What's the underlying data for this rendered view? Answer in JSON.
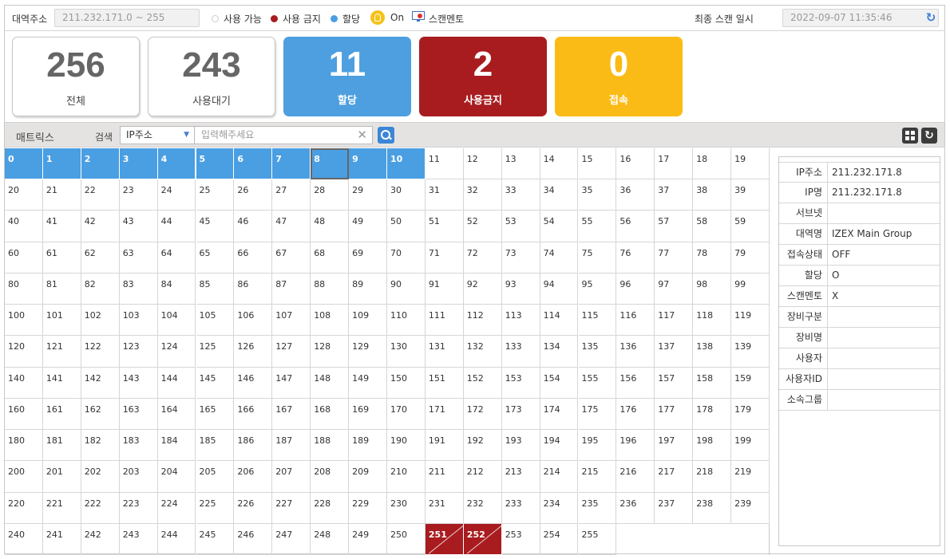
{
  "topbar": {
    "range_label": "대역주소",
    "range_value": "211.232.171.0 ~ 255",
    "legend_available": "사용 가능",
    "legend_blocked": "사용 금지",
    "legend_assigned": "할당",
    "on_label": "On",
    "scanmento_label": "스캔멘토",
    "last_scan_label": "최종 스캔 일시",
    "last_scan_value": "2022-09-07 11:35:46",
    "refresh_icon": "refresh-icon"
  },
  "colors": {
    "assigned": "#4a9ee2",
    "blocked": "#a81c1f",
    "connected": "#fbbb16",
    "available_dot": "#ffffff"
  },
  "cards": [
    {
      "value": "256",
      "label": "전체",
      "style": "white"
    },
    {
      "value": "243",
      "label": "사용대기",
      "style": "white"
    },
    {
      "value": "11",
      "label": "할당",
      "style": "assigned",
      "color": "#4d9fe0"
    },
    {
      "value": "2",
      "label": "사용금지",
      "style": "blocked",
      "color": "#a81c1f"
    },
    {
      "value": "0",
      "label": "접속",
      "style": "connected",
      "color": "#fbbb16"
    }
  ],
  "matrix_header": {
    "title": "매트릭스",
    "search_label": "검색",
    "select_value": "IP주소",
    "input_placeholder": "입력해주세요"
  },
  "matrix": {
    "count": 256,
    "columns": 20,
    "assigned": [
      0,
      1,
      2,
      3,
      4,
      5,
      6,
      7,
      8,
      9,
      10
    ],
    "blocked": [
      251,
      252
    ],
    "selected": 8
  },
  "detail": {
    "rows": [
      {
        "label": "IP주소",
        "value": "211.232.171.8"
      },
      {
        "label": "IP명",
        "value": "211.232.171.8"
      },
      {
        "label": "서브넷",
        "value": ""
      },
      {
        "label": "대역명",
        "value": "IZEX Main Group"
      },
      {
        "label": "접속상태",
        "value": "OFF"
      },
      {
        "label": "할당",
        "value": "O"
      },
      {
        "label": "스캔멘토",
        "value": "X"
      },
      {
        "label": "장비구분",
        "value": ""
      },
      {
        "label": "장비명",
        "value": ""
      },
      {
        "label": "사용자",
        "value": ""
      },
      {
        "label": "사용자ID",
        "value": ""
      },
      {
        "label": "소속그룹",
        "value": ""
      }
    ]
  }
}
